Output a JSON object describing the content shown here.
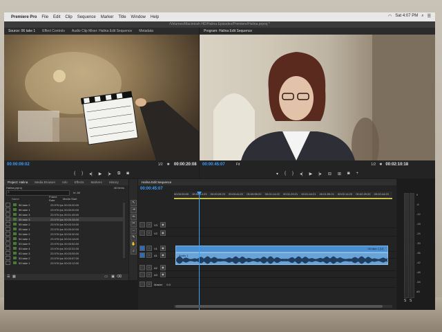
{
  "menubar": {
    "app": "Premiere Pro",
    "items": [
      "File",
      "Edit",
      "Clip",
      "Sequence",
      "Marker",
      "Title",
      "Window",
      "Help"
    ],
    "clock": "Sat 4:07 PM"
  },
  "window": {
    "title": "/Volumes/Macintosh HD/Halina Episodes/Premiere/Halina.prproj *"
  },
  "source_panel": {
    "tabs": [
      "Source: 06 take 1",
      "Effect Controls",
      "Audio Clip Mixer: Halina Edit Sequence",
      "Metadata"
    ],
    "timecode_in": "00:00:09:02",
    "fit": "1/2",
    "timecode_out": "00:00:20:08"
  },
  "program_panel": {
    "tabs": [
      "Program: Halina Edit Sequence"
    ],
    "timecode_in": "00:00:45:07",
    "fit": "Fit",
    "zoom": "1/2",
    "timecode_out": "00:02:10:18"
  },
  "project_panel": {
    "tabs": [
      "Project: Halina",
      "Media Browser",
      "Info",
      "Effects",
      "Markers",
      "History"
    ],
    "project_file": "Halina.prproj",
    "item_count": "46 Items",
    "search_placeholder": "",
    "in_label": "In:",
    "in_value": "All",
    "columns": [
      "Name",
      "Frame Rate",
      "Media Start"
    ],
    "rows": [
      {
        "name": "56 take 2",
        "fps": "23.976 fps",
        "start": "00:00:00:00"
      },
      {
        "name": "56 take 1",
        "fps": "23.976 fps",
        "start": "00:00:00:00"
      },
      {
        "name": "56 take 3",
        "fps": "23.976 fps",
        "start": "00:01:45:00"
      },
      {
        "name": "55 take 3",
        "fps": "23.976 fps",
        "start": "00:00:28:00"
      },
      {
        "name": "55 take 2",
        "fps": "23.976 fps",
        "start": "00:02:24:00"
      },
      {
        "name": "55 take 1",
        "fps": "23.976 fps",
        "start": "00:00:00:00"
      },
      {
        "name": "54 take 2",
        "fps": "23.976 fps",
        "start": "00:00:30:00"
      },
      {
        "name": "54 take 1",
        "fps": "23.976 fps",
        "start": "00:04:18:00"
      },
      {
        "name": "53 take 5",
        "fps": "23.976 fps",
        "start": "00:00:52:00"
      },
      {
        "name": "53 take 4",
        "fps": "23.976 fps",
        "start": "00:02:31:00"
      },
      {
        "name": "53 take 3",
        "fps": "23.976 fps",
        "start": "00:03:05:00"
      },
      {
        "name": "53 take 2",
        "fps": "23.976 fps",
        "start": "00:00:57:00"
      },
      {
        "name": "53 take 1",
        "fps": "23.976 fps",
        "start": "00:02:12:00"
      }
    ]
  },
  "timeline": {
    "tab": "Halina Edit Sequence",
    "timecode": "00:00:45:07",
    "ruler": [
      "00:00:00:00",
      "00:00:14:23",
      "00:00:29:23",
      "00:00:44:22",
      "00:00:59:22",
      "00:01:14:22",
      "00:01:29:21",
      "00:01:44:21",
      "00:01:59:21",
      "00:02:14:20",
      "00:02:29:20",
      "00:02:44:20"
    ],
    "tracks": [
      "V3",
      "V2",
      "V1",
      "A1",
      "A2",
      "A3",
      "Master"
    ],
    "v1_clip": "06 take 1 [V]",
    "a_label": "Audio 1",
    "master_value": "0.0"
  },
  "meters": {
    "scale": [
      "0",
      "-6",
      "-12",
      "-18",
      "-24",
      "-30",
      "-36",
      "-42",
      "-48",
      "-54",
      "dB"
    ],
    "solo": [
      "S",
      "S"
    ]
  },
  "icons": {
    "apple": "apple-icon",
    "wifi": "wifi-icon",
    "search": "search-icon",
    "play": "play-icon",
    "step_back": "step-back-icon",
    "step_fwd": "step-forward-icon",
    "mark_in": "mark-in-icon",
    "mark_out": "mark-out-icon",
    "wrench": "wrench-icon",
    "camera": "camera-icon",
    "selection": "selection-tool-icon",
    "razor": "razor-tool-icon"
  }
}
